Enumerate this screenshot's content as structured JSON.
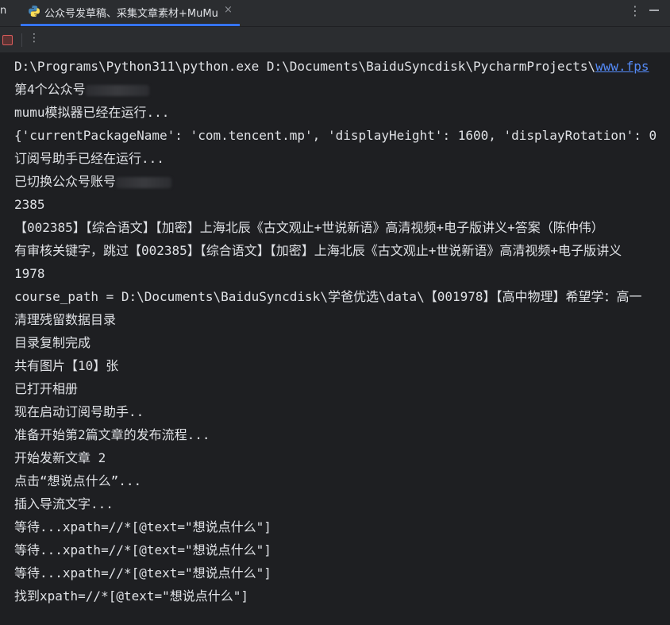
{
  "tabbar": {
    "left_fragment": "n",
    "active_tab": {
      "title": "公众号发草稿、采集文章素材+MuMu",
      "close": "×"
    },
    "more": "⋮"
  },
  "toolbar": {
    "more": "⋮"
  },
  "console": {
    "lines": [
      {
        "text": "D:\\Programs\\Python311\\python.exe D:\\Documents\\BaiduSyncdisk\\PycharmProjects\\",
        "link": "www.fps"
      },
      {
        "text": "第4个公众号",
        "redacted": true
      },
      {
        "text": "mumu模拟器已经在运行..."
      },
      {
        "text": "{'currentPackageName': 'com.tencent.mp', 'displayHeight': 1600, 'displayRotation': 0"
      },
      {
        "text": "订阅号助手已经在运行..."
      },
      {
        "text": "已切换公众号账号",
        "redacted": true
      },
      {
        "text": "2385"
      },
      {
        "text": "【002385】【综合语文】【加密】上海北辰《古文观止+世说新语》高清视频+电子版讲义+答案（陈仲伟）"
      },
      {
        "text": "有审核关键字，跳过【002385】【综合语文】【加密】上海北辰《古文观止+世说新语》高清视频+电子版讲义"
      },
      {
        "text": "1978"
      },
      {
        "text": "course_path = D:\\Documents\\BaiduSyncdisk\\学爸优选\\data\\【001978】【高中物理】希望学：高一"
      },
      {
        "text": "清理残留数据目录"
      },
      {
        "text": "目录复制完成"
      },
      {
        "text": "共有图片【10】张"
      },
      {
        "text": "已打开相册"
      },
      {
        "text": "现在启动订阅号助手.."
      },
      {
        "text": "准备开始第2篇文章的发布流程..."
      },
      {
        "text": "开始发新文章 2"
      },
      {
        "text": "点击“想说点什么”..."
      },
      {
        "text": "插入导流文字..."
      },
      {
        "text": "等待...xpath=//*[@text=\"想说点什么\"]"
      },
      {
        "text": "等待...xpath=//*[@text=\"想说点什么\"]"
      },
      {
        "text": "等待...xpath=//*[@text=\"想说点什么\"]"
      },
      {
        "text": "找到xpath=//*[@text=\"想说点什么\"]"
      }
    ]
  },
  "colors": {
    "accent": "#3574f0",
    "link": "#548af7",
    "stop": "#db5c5c",
    "console_bg": "#1e1f22",
    "chrome_bg": "#2b2d30",
    "text": "#dfe1e5"
  },
  "icons": {
    "tab_icon": "python-icon",
    "stop": "stop-icon",
    "more": "kebab-menu-icon",
    "minimize": "minimize-icon"
  }
}
